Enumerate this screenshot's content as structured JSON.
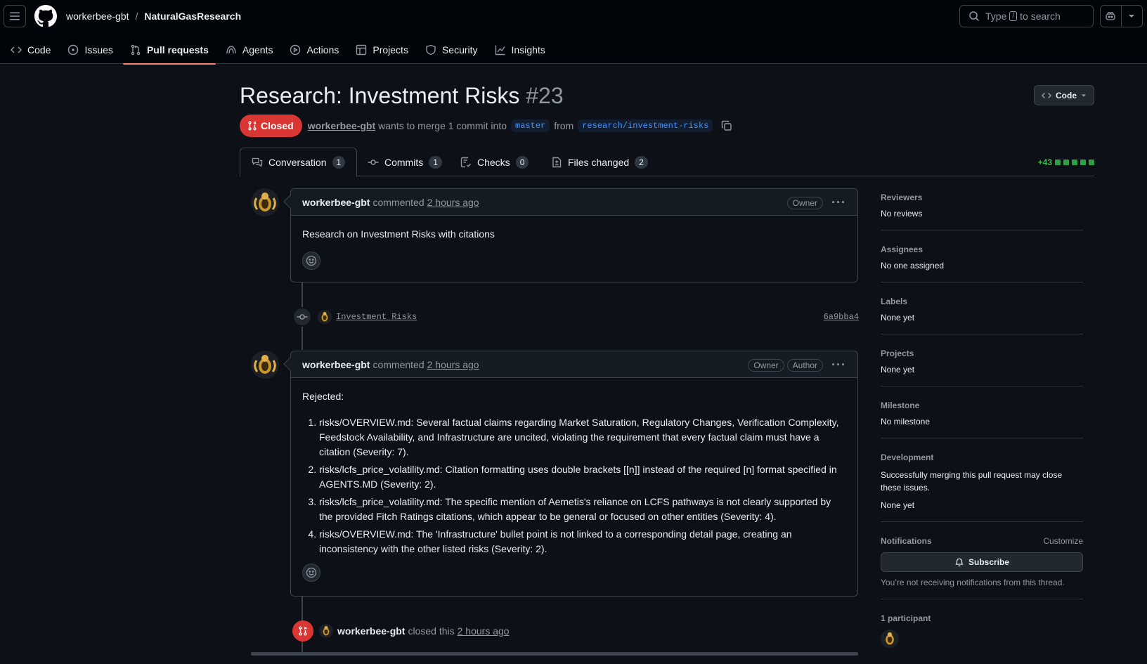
{
  "header": {
    "owner": "workerbee-gbt",
    "separator": "/",
    "repo": "NaturalGasResearch",
    "search_prefix": "Type",
    "search_key": "/",
    "search_suffix": "to search"
  },
  "repo_nav": [
    {
      "label": "Code",
      "icon": "code-icon"
    },
    {
      "label": "Issues",
      "icon": "issue-icon"
    },
    {
      "label": "Pull requests",
      "icon": "pull-request-icon",
      "active": true
    },
    {
      "label": "Agents",
      "icon": "agents-icon"
    },
    {
      "label": "Actions",
      "icon": "play-icon"
    },
    {
      "label": "Projects",
      "icon": "table-icon"
    },
    {
      "label": "Security",
      "icon": "shield-icon"
    },
    {
      "label": "Insights",
      "icon": "graph-icon"
    }
  ],
  "pr": {
    "title": "Research: Investment Risks",
    "number": "#23",
    "code_button": "Code",
    "state": "Closed",
    "author": "workerbee-gbt",
    "merge_text": "wants to merge 1 commit into",
    "base_branch": "master",
    "from_text": "from",
    "head_branch": "research/investment-risks"
  },
  "tabs": [
    {
      "label": "Conversation",
      "count": "1"
    },
    {
      "label": "Commits",
      "count": "1"
    },
    {
      "label": "Checks",
      "count": "0"
    },
    {
      "label": "Files changed",
      "count": "2"
    }
  ],
  "diffstat": "+43",
  "comments": [
    {
      "author": "workerbee-gbt",
      "action": "commented",
      "time": "2 hours ago",
      "labels": [
        "Owner"
      ],
      "body": "Research on Investment Risks with citations"
    },
    {
      "author": "workerbee-gbt",
      "action": "commented",
      "time": "2 hours ago",
      "labels": [
        "Owner",
        "Author"
      ],
      "intro": "Rejected:",
      "items": [
        "risks/OVERVIEW.md: Several factual claims regarding Market Saturation, Regulatory Changes, Verification Complexity, Feedstock Availability, and Infrastructure are uncited, violating the requirement that every factual claim must have a citation (Severity: 7).",
        "risks/lcfs_price_volatility.md: Citation formatting uses double brackets [[n]] instead of the required [n] format specified in AGENTS.MD (Severity: 2).",
        "risks/lcfs_price_volatility.md: The specific mention of Aemetis's reliance on LCFS pathways is not clearly supported by the provided Fitch Ratings citations, which appear to be general or focused on other entities (Severity: 4).",
        "risks/OVERVIEW.md: The 'Infrastructure' bullet point is not linked to a corresponding detail page, creating an inconsistency with the other listed risks (Severity: 2)."
      ]
    }
  ],
  "commit": {
    "message": "Investment Risks",
    "sha": "6a9bba4"
  },
  "closed_event": {
    "author": "workerbee-gbt",
    "action": "closed this",
    "time": "2 hours ago"
  },
  "sidebar": {
    "reviewers": {
      "heading": "Reviewers",
      "value": "No reviews"
    },
    "assignees": {
      "heading": "Assignees",
      "value": "No one assigned"
    },
    "labels": {
      "heading": "Labels",
      "value": "None yet"
    },
    "projects": {
      "heading": "Projects",
      "value": "None yet"
    },
    "milestone": {
      "heading": "Milestone",
      "value": "No milestone"
    },
    "development": {
      "heading": "Development",
      "description": "Successfully merging this pull request may close these issues.",
      "value": "None yet"
    },
    "notifications": {
      "heading": "Notifications",
      "customize": "Customize",
      "subscribe": "Subscribe",
      "note": "You’re not receiving notifications from this thread."
    },
    "participants": {
      "heading": "1 participant"
    }
  },
  "colors": {
    "background": "#0d1117",
    "closed": "#da3633",
    "link": "#4493f8",
    "additions": "#2ea043",
    "nav_underline": "#f78166"
  }
}
